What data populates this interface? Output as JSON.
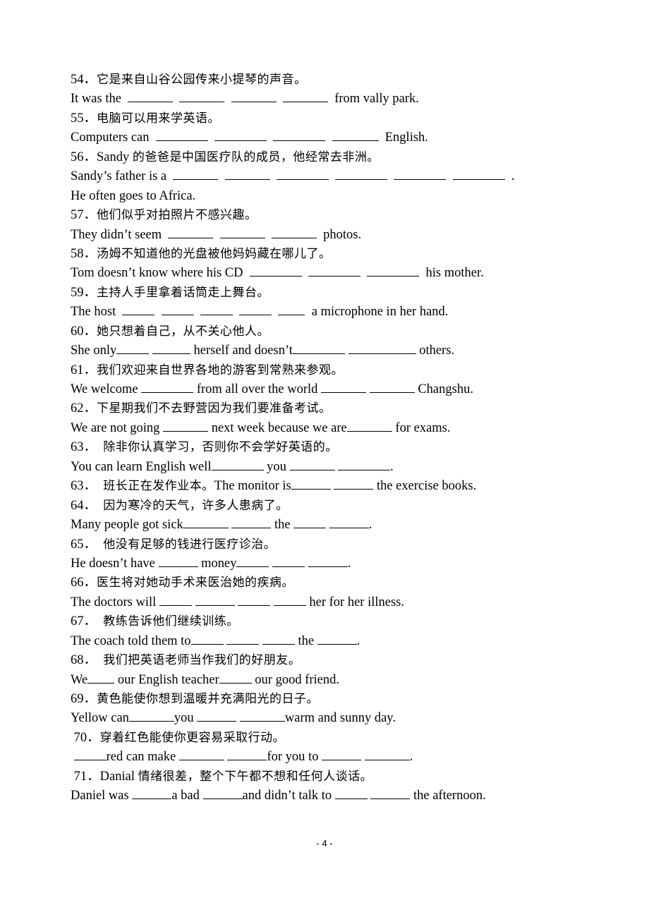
{
  "page_number": "- 4 -",
  "lines": [
    {
      "type": "zh",
      "segs": [
        {
          "t": "num",
          "v": "54．"
        },
        {
          "t": "text",
          "v": "它是来自山谷公园传来小提琴的声音。"
        }
      ]
    },
    {
      "type": "en",
      "segs": [
        {
          "t": "text",
          "v": "It was the  "
        },
        {
          "t": "blank",
          "w": 64
        },
        {
          "t": "text",
          "v": "  "
        },
        {
          "t": "blank",
          "w": 64
        },
        {
          "t": "text",
          "v": "  "
        },
        {
          "t": "blank",
          "w": 64
        },
        {
          "t": "text",
          "v": "  "
        },
        {
          "t": "blank",
          "w": 64
        },
        {
          "t": "text",
          "v": "  from vally park."
        }
      ]
    },
    {
      "type": "zh",
      "segs": [
        {
          "t": "num",
          "v": "55．"
        },
        {
          "t": "text",
          "v": "电脑可以用来学英语。"
        }
      ]
    },
    {
      "type": "en",
      "segs": [
        {
          "t": "text",
          "v": "Computers can  "
        },
        {
          "t": "blank",
          "w": 74
        },
        {
          "t": "text",
          "v": "  "
        },
        {
          "t": "blank",
          "w": 74
        },
        {
          "t": "text",
          "v": "  "
        },
        {
          "t": "blank",
          "w": 74
        },
        {
          "t": "text",
          "v": "  "
        },
        {
          "t": "blank",
          "w": 66
        },
        {
          "t": "text",
          "v": "  English."
        }
      ]
    },
    {
      "type": "zh",
      "segs": [
        {
          "t": "num",
          "v": "56．"
        },
        {
          "t": "en",
          "v": "Sandy "
        },
        {
          "t": "text",
          "v": "的爸爸是中国医疗队的成员，他经常去非洲。"
        }
      ]
    },
    {
      "type": "en",
      "segs": [
        {
          "t": "text",
          "v": "Sandy’s father is a  "
        },
        {
          "t": "blank",
          "w": 64
        },
        {
          "t": "text",
          "v": "  "
        },
        {
          "t": "blank",
          "w": 64
        },
        {
          "t": "text",
          "v": "  "
        },
        {
          "t": "blank",
          "w": 74
        },
        {
          "t": "text",
          "v": "  "
        },
        {
          "t": "blank",
          "w": 74
        },
        {
          "t": "text",
          "v": "  "
        },
        {
          "t": "blank",
          "w": 74
        },
        {
          "t": "text",
          "v": "  "
        },
        {
          "t": "blank",
          "w": 74
        },
        {
          "t": "text",
          "v": "  ."
        }
      ]
    },
    {
      "type": "en",
      "segs": [
        {
          "t": "text",
          "v": "He often goes to Africa."
        }
      ]
    },
    {
      "type": "zh",
      "segs": [
        {
          "t": "num",
          "v": "57．"
        },
        {
          "t": "text",
          "v": "他们似乎对拍照片不感兴趣。"
        }
      ]
    },
    {
      "type": "en",
      "segs": [
        {
          "t": "text",
          "v": "They didn’t seem  "
        },
        {
          "t": "blank",
          "w": 64
        },
        {
          "t": "text",
          "v": "  "
        },
        {
          "t": "blank",
          "w": 64
        },
        {
          "t": "text",
          "v": "  "
        },
        {
          "t": "blank",
          "w": 64
        },
        {
          "t": "text",
          "v": "  photos."
        }
      ]
    },
    {
      "type": "zh",
      "segs": [
        {
          "t": "num",
          "v": "58．"
        },
        {
          "t": "text",
          "v": "汤姆不知道他的光盘被他妈妈藏在哪儿了。"
        }
      ]
    },
    {
      "type": "en",
      "segs": [
        {
          "t": "text",
          "v": "Tom doesn’t know where his CD  "
        },
        {
          "t": "blank",
          "w": 74
        },
        {
          "t": "text",
          "v": "  "
        },
        {
          "t": "blank",
          "w": 74
        },
        {
          "t": "text",
          "v": "  "
        },
        {
          "t": "blank",
          "w": 74
        },
        {
          "t": "text",
          "v": "  his mother."
        }
      ]
    },
    {
      "type": "zh",
      "segs": [
        {
          "t": "num",
          "v": "59．"
        },
        {
          "t": "text",
          "v": "主持人手里拿着话筒走上舞台。"
        }
      ]
    },
    {
      "type": "en",
      "segs": [
        {
          "t": "text",
          "v": "The host  "
        },
        {
          "t": "blank",
          "w": 46
        },
        {
          "t": "text",
          "v": "  "
        },
        {
          "t": "blank",
          "w": 46
        },
        {
          "t": "text",
          "v": "  "
        },
        {
          "t": "blank",
          "w": 46
        },
        {
          "t": "text",
          "v": "  "
        },
        {
          "t": "blank",
          "w": 46
        },
        {
          "t": "text",
          "v": "  "
        },
        {
          "t": "blank",
          "w": 38
        },
        {
          "t": "text",
          "v": "  a microphone in her hand."
        }
      ]
    },
    {
      "type": "zh",
      "segs": [
        {
          "t": "num",
          "v": "60．"
        },
        {
          "t": "text",
          "v": "她只想着自己，从不关心他人。"
        }
      ]
    },
    {
      "type": "en",
      "segs": [
        {
          "t": "text",
          "v": "She only"
        },
        {
          "t": "blank",
          "w": 46
        },
        {
          "t": "text",
          "v": " "
        },
        {
          "t": "blank",
          "w": 54
        },
        {
          "t": "text",
          "v": " herself and doesn’t"
        },
        {
          "t": "blank",
          "w": 74
        },
        {
          "t": "text",
          "v": " "
        },
        {
          "t": "blank",
          "w": 96
        },
        {
          "t": "text",
          "v": " others."
        }
      ]
    },
    {
      "type": "zh",
      "segs": [
        {
          "t": "num",
          "v": "61．"
        },
        {
          "t": "text",
          "v": "我们欢迎来自世界各地的游客到常熟来参观。"
        }
      ]
    },
    {
      "type": "en",
      "segs": [
        {
          "t": "text",
          "v": "We welcome "
        },
        {
          "t": "blank",
          "w": 74
        },
        {
          "t": "text",
          "v": " from all over the world "
        },
        {
          "t": "blank",
          "w": 64
        },
        {
          "t": "text",
          "v": " "
        },
        {
          "t": "blank",
          "w": 64
        },
        {
          "t": "text",
          "v": " Changshu."
        }
      ]
    },
    {
      "type": "zh",
      "segs": [
        {
          "t": "num",
          "v": "62．"
        },
        {
          "t": "text",
          "v": "下星期我们不去野营因为我们要准备考试。"
        }
      ]
    },
    {
      "type": "en",
      "segs": [
        {
          "t": "text",
          "v": "We are not going "
        },
        {
          "t": "blank",
          "w": 64
        },
        {
          "t": "text",
          "v": " next week because we are"
        },
        {
          "t": "blank",
          "w": 64
        },
        {
          "t": "text",
          "v": " for exams."
        }
      ]
    },
    {
      "type": "zh",
      "segs": [
        {
          "t": "num",
          "v": "63．　"
        },
        {
          "t": "text",
          "v": "除非你认真学习，否则你不会学好英语的。"
        }
      ]
    },
    {
      "type": "en",
      "segs": [
        {
          "t": "text",
          "v": "You can learn English well"
        },
        {
          "t": "blank",
          "w": 74
        },
        {
          "t": "text",
          "v": " you "
        },
        {
          "t": "blank",
          "w": 64
        },
        {
          "t": "text",
          "v": " "
        },
        {
          "t": "blank",
          "w": 74
        },
        {
          "t": "text",
          "v": "."
        }
      ]
    },
    {
      "type": "zh",
      "segs": [
        {
          "t": "num",
          "v": "63．　"
        },
        {
          "t": "text",
          "v": "班长正在发作业本。"
        },
        {
          "t": "en",
          "v": "The monitor is"
        },
        {
          "t": "blank",
          "w": 56
        },
        {
          "t": "en",
          "v": " "
        },
        {
          "t": "blank",
          "w": 56
        },
        {
          "t": "en",
          "v": " the exercise books."
        }
      ]
    },
    {
      "type": "zh",
      "segs": [
        {
          "t": "num",
          "v": "64．　"
        },
        {
          "t": "text",
          "v": "因为寒冷的天气，许多人患病了。"
        }
      ]
    },
    {
      "type": "en",
      "segs": [
        {
          "t": "text",
          "v": "Many people got sick"
        },
        {
          "t": "blank",
          "w": 64
        },
        {
          "t": "text",
          "v": " "
        },
        {
          "t": "blank",
          "w": 56
        },
        {
          "t": "text",
          "v": " the "
        },
        {
          "t": "blank",
          "w": 46
        },
        {
          "t": "text",
          "v": " "
        },
        {
          "t": "blank",
          "w": 56
        },
        {
          "t": "text",
          "v": "."
        }
      ]
    },
    {
      "type": "zh",
      "segs": [
        {
          "t": "num",
          "v": "65．　"
        },
        {
          "t": "text",
          "v": "他没有足够的钱进行医疗诊治。"
        }
      ]
    },
    {
      "type": "en",
      "segs": [
        {
          "t": "text",
          "v": "He doesn’t have "
        },
        {
          "t": "blank",
          "w": 56
        },
        {
          "t": "text",
          "v": " money"
        },
        {
          "t": "blank",
          "w": 46
        },
        {
          "t": "text",
          "v": " "
        },
        {
          "t": "blank",
          "w": 46
        },
        {
          "t": "text",
          "v": " "
        },
        {
          "t": "blank",
          "w": 56
        },
        {
          "t": "text",
          "v": "."
        }
      ]
    },
    {
      "type": "zh",
      "segs": [
        {
          "t": "num",
          "v": "66．"
        },
        {
          "t": "text",
          "v": "医生将对她动手术来医治她的疾病。"
        }
      ]
    },
    {
      "type": "en",
      "segs": [
        {
          "t": "text",
          "v": "The doctors will "
        },
        {
          "t": "blank",
          "w": 46
        },
        {
          "t": "text",
          "v": " "
        },
        {
          "t": "blank",
          "w": 56
        },
        {
          "t": "text",
          "v": " "
        },
        {
          "t": "blank",
          "w": 46
        },
        {
          "t": "text",
          "v": " "
        },
        {
          "t": "blank",
          "w": 46
        },
        {
          "t": "text",
          "v": " her for her illness."
        }
      ]
    },
    {
      "type": "zh",
      "segs": [
        {
          "t": "num",
          "v": "67．　"
        },
        {
          "t": "text",
          "v": "教练告诉他们继续训练。"
        }
      ]
    },
    {
      "type": "en",
      "segs": [
        {
          "t": "text",
          "v": "The coach told them to"
        },
        {
          "t": "blank",
          "w": 46
        },
        {
          "t": "text",
          "v": " "
        },
        {
          "t": "blank",
          "w": 46
        },
        {
          "t": "text",
          "v": " "
        },
        {
          "t": "blank",
          "w": 46
        },
        {
          "t": "text",
          "v": " the "
        },
        {
          "t": "blank",
          "w": 56
        },
        {
          "t": "text",
          "v": "."
        }
      ]
    },
    {
      "type": "zh",
      "segs": [
        {
          "t": "num",
          "v": "68．　"
        },
        {
          "t": "text",
          "v": "我们把英语老师当作我们的好朋友。"
        }
      ]
    },
    {
      "type": "en",
      "segs": [
        {
          "t": "text",
          "v": "We"
        },
        {
          "t": "blank",
          "w": 38
        },
        {
          "t": "text",
          "v": " our English teacher"
        },
        {
          "t": "blank",
          "w": 46
        },
        {
          "t": "text",
          "v": " our good friend."
        }
      ]
    },
    {
      "type": "zh",
      "segs": [
        {
          "t": "num",
          "v": "69．"
        },
        {
          "t": "text",
          "v": "黄色能使你想到温暖并充满阳光的日子。"
        }
      ]
    },
    {
      "type": "en",
      "segs": [
        {
          "t": "text",
          "v": "Yellow can"
        },
        {
          "t": "blank",
          "w": 64
        },
        {
          "t": "text",
          "v": "you "
        },
        {
          "t": "blank",
          "w": 56
        },
        {
          "t": "text",
          "v": " "
        },
        {
          "t": "blank",
          "w": 64
        },
        {
          "t": "text",
          "v": "warm and sunny day."
        }
      ]
    },
    {
      "type": "zh",
      "segs": [
        {
          "t": "num",
          "v": " 70．"
        },
        {
          "t": "text",
          "v": "穿着红色能使你更容易采取行动。"
        }
      ]
    },
    {
      "type": "en",
      "segs": [
        {
          "t": "text",
          "v": " "
        },
        {
          "t": "blank",
          "w": 46
        },
        {
          "t": "text",
          "v": "red can make "
        },
        {
          "t": "blank",
          "w": 64
        },
        {
          "t": "text",
          "v": " "
        },
        {
          "t": "blank",
          "w": 56
        },
        {
          "t": "text",
          "v": "for you to "
        },
        {
          "t": "blank",
          "w": 56
        },
        {
          "t": "text",
          "v": " "
        },
        {
          "t": "blank",
          "w": 64
        },
        {
          "t": "text",
          "v": "."
        }
      ]
    },
    {
      "type": "zh",
      "segs": [
        {
          "t": "num",
          "v": " 71．"
        },
        {
          "t": "en",
          "v": "Danial "
        },
        {
          "t": "text",
          "v": "情绪很差，整个下午都不想和任何人谈话。"
        }
      ]
    },
    {
      "type": "en",
      "segs": [
        {
          "t": "text",
          "v": "Daniel was "
        },
        {
          "t": "blank",
          "w": 56
        },
        {
          "t": "text",
          "v": "a bad "
        },
        {
          "t": "blank",
          "w": 56
        },
        {
          "t": "text",
          "v": "and didn’t talk to "
        },
        {
          "t": "blank",
          "w": 46
        },
        {
          "t": "text",
          "v": " "
        },
        {
          "t": "blank",
          "w": 56
        },
        {
          "t": "text",
          "v": " the afternoon."
        }
      ]
    }
  ]
}
